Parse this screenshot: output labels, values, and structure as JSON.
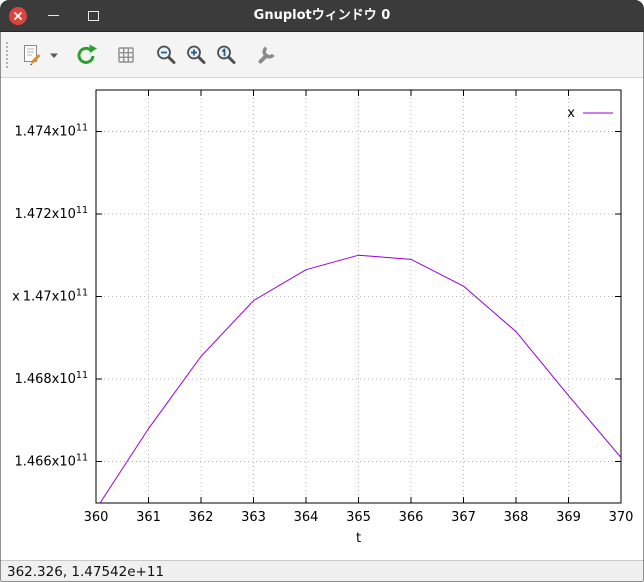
{
  "window": {
    "title": "Gnuplotウィンドウ 0"
  },
  "toolbar": {
    "buttons": [
      {
        "name": "export",
        "icon": "export-icon"
      },
      {
        "name": "export-menu",
        "icon": "dropdown-arrow-icon"
      },
      {
        "name": "replot",
        "icon": "refresh-icon"
      },
      {
        "name": "toggle-grid",
        "icon": "grid-icon"
      },
      {
        "name": "zoom-out",
        "icon": "zoom-out-icon"
      },
      {
        "name": "zoom-in",
        "icon": "zoom-in-icon"
      },
      {
        "name": "restore-zoom",
        "icon": "zoom-original-icon"
      },
      {
        "name": "settings",
        "icon": "wrench-icon"
      }
    ]
  },
  "statusbar": {
    "coordinates": "362.326, 1.47542e+11"
  },
  "colors": {
    "series_x": "#9400d3",
    "titlebar": "#3b3b3b",
    "close_button": "#d9453d",
    "refresh_icon": "#2f9e2f"
  },
  "chart_data": {
    "type": "line",
    "title": "",
    "xlabel": "t",
    "ylabel": "x",
    "xlim": [
      360,
      370
    ],
    "ylim": [
      146500000000.0,
      147500000000.0
    ],
    "x_ticks": [
      360,
      361,
      362,
      363,
      364,
      365,
      366,
      367,
      368,
      369,
      370
    ],
    "y_ticks": [
      {
        "label": "1.466x10",
        "sup": "11",
        "value": 146600000000.0
      },
      {
        "label": "1.468x10",
        "sup": "11",
        "value": 146800000000.0
      },
      {
        "label": "1.47x10",
        "sup": "11",
        "value": 147000000000.0
      },
      {
        "label": "1.472x10",
        "sup": "11",
        "value": 147200000000.0
      },
      {
        "label": "1.474x10",
        "sup": "11",
        "value": 147400000000.0
      }
    ],
    "grid": true,
    "legend": {
      "position": "top-right",
      "entries": [
        "x"
      ]
    },
    "series": [
      {
        "name": "x",
        "color": "#9400d3",
        "x": [
          360,
          361,
          362,
          363,
          364,
          365,
          366,
          367,
          368,
          369,
          370
        ],
        "y": [
          146485000000.0,
          146680000000.0,
          146855000000.0,
          146990000000.0,
          147065000000.0,
          147100000000.0,
          147090000000.0,
          147025000000.0,
          146915000000.0,
          146760000000.0,
          146610000000.0
        ]
      }
    ]
  }
}
